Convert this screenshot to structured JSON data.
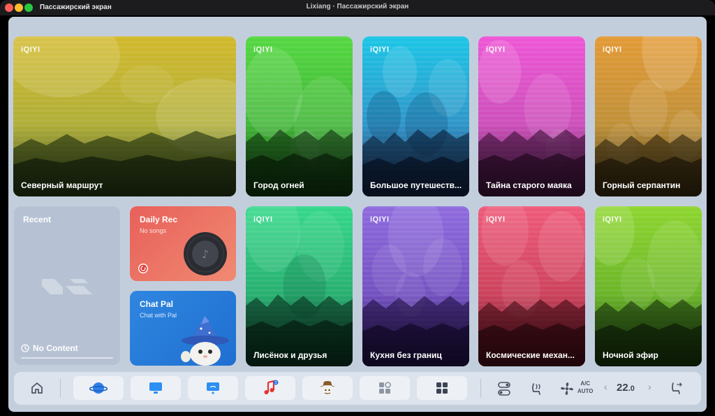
{
  "window": {
    "app_name": "Пассажирский экран",
    "title": "Lixiang · Пассажирский экран"
  },
  "brand_label": "iQIYI",
  "cards": [
    {
      "title": "Северный маршрут",
      "top": "#d2b92c",
      "bottom": "#94a642"
    },
    {
      "title": "Город огней",
      "top": "#55d842",
      "bottom": "#2f9a2c"
    },
    {
      "title": "Большое путешеств...",
      "top": "#1cc6e6",
      "bottom": "#3f6fb2"
    },
    {
      "title": "Тайна старого маяка",
      "top": "#ee56d6",
      "bottom": "#b14aa4"
    },
    {
      "title": "Горный серпантин",
      "top": "#e39a36",
      "bottom": "#a3883a"
    },
    {
      "title": "Лисёнок и друзья",
      "top": "#34d88a",
      "bottom": "#1f8f5c"
    },
    {
      "title": "Кухня без границ",
      "top": "#8f6bde",
      "bottom": "#5c3ca8"
    },
    {
      "title": "Космические механ...",
      "top": "#ef5a7a",
      "bottom": "#b02f45"
    },
    {
      "title": "Ночной эфир",
      "top": "#8ed62f",
      "bottom": "#4e9a24"
    }
  ],
  "recent": {
    "title": "Recent",
    "empty_text": "No Content"
  },
  "daily_rec": {
    "title": "Daily Rec",
    "subtitle": "No songs"
  },
  "chat_pal": {
    "title": "Chat Pal",
    "subtitle": "Chat with Pal"
  },
  "dock": {
    "items": [
      "home-icon",
      "planet-icon",
      "screen-mirror-icon",
      "screen-cast-icon",
      "music-note-icon",
      "cowboy-game-icon",
      "app-store-icon",
      "app-grid-icon",
      "toggle-controls-icon",
      "seat-heat-icon",
      "fan-icon",
      "seat-adjust-icon"
    ],
    "music_badge": "3",
    "ac_label": "A/C",
    "ac_mode": "AUTO",
    "temperature": "22",
    "temperature_decimal": ".0"
  },
  "colors": {
    "screen_bg": "#c3cedd",
    "dock_bg": "#dde3ec",
    "daily_rec": "#e8605a",
    "chat_pal": "#2f86e0"
  }
}
